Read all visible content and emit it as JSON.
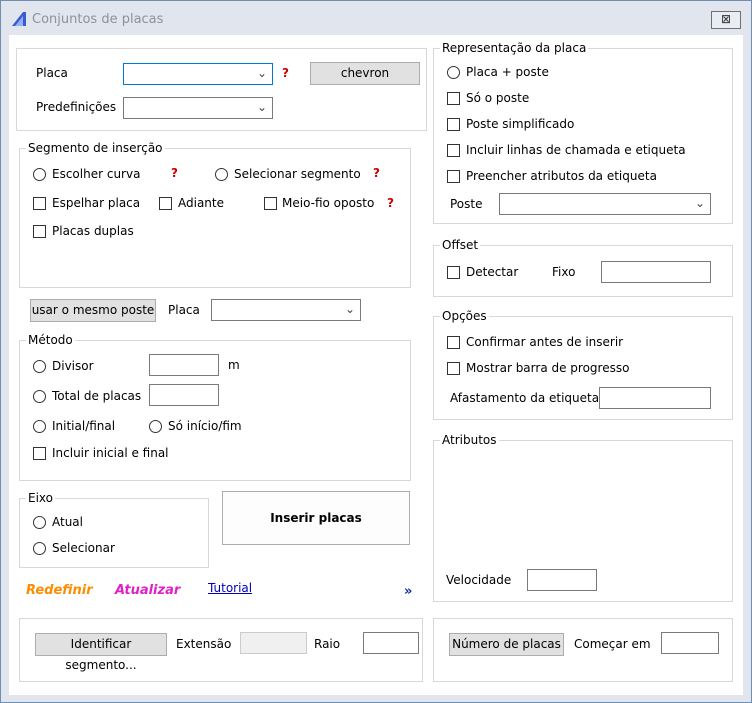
{
  "window": {
    "title": "Conjuntos de placas",
    "close_glyph": "⊠"
  },
  "top": {
    "placa_label": "Placa",
    "placa_value": "",
    "placa_q": "?",
    "chevron_button": "chevron",
    "predef_label": "Predefinições",
    "predef_value": ""
  },
  "segmento": {
    "title": "Segmento de inserção",
    "escolher_curva": "Escolher curva",
    "escolher_q": "?",
    "selecionar_segmento": "Selecionar segmento",
    "selecionar_q": "?",
    "espelhar": "Espelhar placa",
    "adiante": "Adiante",
    "meio_fio": "Meio-fio oposto",
    "meio_fio_q": "?",
    "duplas": "Placas duplas"
  },
  "mesmo": {
    "button": "usar o mesmo poste",
    "placa_label": "Placa",
    "placa_value": ""
  },
  "metodo": {
    "title": "Método",
    "divisor": "Divisor",
    "divisor_unit": "m",
    "divisor_value": "",
    "total": "Total de placas",
    "total_value": "",
    "initial_final": "Initial/final",
    "so_inicio": "Só início/fim",
    "incluir": "Incluir inicial e final"
  },
  "eixo": {
    "title": "Eixo",
    "atual": "Atual",
    "selecionar": "Selecionar"
  },
  "inserir_button": "Inserir placas",
  "links": {
    "redefinir": "Redefinir",
    "atualizar": "Atualizar",
    "tutorial": "Tutorial",
    "more": "»"
  },
  "bottom_left": {
    "identificar_button": "Identificar segmento...",
    "extensao_label": "Extensão",
    "extensao_value": "",
    "raio_label": "Raio",
    "raio_value": ""
  },
  "representacao": {
    "title": "Representação da placa",
    "placa_poste": "Placa + poste",
    "so_poste": "Só o poste",
    "simplificado": "Poste simplificado",
    "linhas": "Incluir linhas de chamada e etiqueta",
    "preencher": "Preencher atributos da etiqueta",
    "poste_label": "Poste",
    "poste_value": ""
  },
  "offset": {
    "title": "Offset",
    "detectar": "Detectar",
    "fixo_label": "Fixo",
    "fixo_value": ""
  },
  "opcoes": {
    "title": "Opções",
    "confirmar": "Confirmar antes de inserir",
    "mostrar": "Mostrar barra de progresso",
    "afastamento_label": "Afastamento da etiqueta",
    "afastamento_value": ""
  },
  "atributos": {
    "title": "Atributos",
    "velocidade_label": "Velocidade",
    "velocidade_value": ""
  },
  "bottom_right": {
    "numero_button": "Número de placas",
    "comecar_label": "Começar em",
    "comecar_value": ""
  }
}
